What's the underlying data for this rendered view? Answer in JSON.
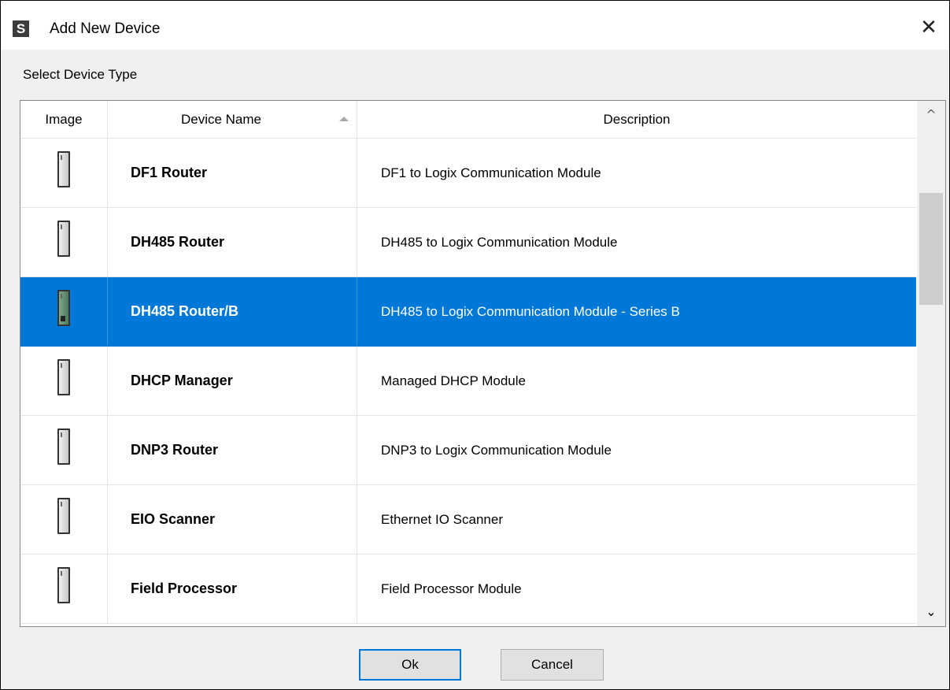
{
  "window": {
    "title": "Add New Device",
    "app_icon_letter": "S",
    "close_glyph": "✕"
  },
  "section_label": "Select Device Type",
  "table": {
    "columns": [
      "Image",
      "Device Name",
      "Description"
    ],
    "sort_column": "Device Name",
    "sort_direction": "ascending",
    "rows": [
      {
        "name": "DF1 Router",
        "description": "DF1 to Logix Communication Module",
        "icon": "device-module-icon",
        "selected": false
      },
      {
        "name": "DH485 Router",
        "description": "DH485 to Logix Communication Module",
        "icon": "device-module-icon",
        "selected": false
      },
      {
        "name": "DH485 Router/B",
        "description": "DH485 to Logix Communication Module - Series B",
        "icon": "device-module-icon",
        "selected": true
      },
      {
        "name": "DHCP Manager",
        "description": "Managed DHCP Module",
        "icon": "device-module-icon",
        "selected": false
      },
      {
        "name": "DNP3 Router",
        "description": "DNP3 to Logix Communication Module",
        "icon": "device-module-icon",
        "selected": false
      },
      {
        "name": "EIO Scanner",
        "description": "Ethernet IO Scanner",
        "icon": "device-module-icon",
        "selected": false
      },
      {
        "name": "Field Processor",
        "description": "Field Processor Module",
        "icon": "device-module-icon",
        "selected": false
      }
    ]
  },
  "scrollbar": {
    "up_glyph": "^",
    "down_glyph": "⌄"
  },
  "buttons": {
    "ok_label": "Ok",
    "cancel_label": "Cancel"
  },
  "colors": {
    "selection": "#0078d7",
    "dialog_background": "#f0f0f0"
  }
}
